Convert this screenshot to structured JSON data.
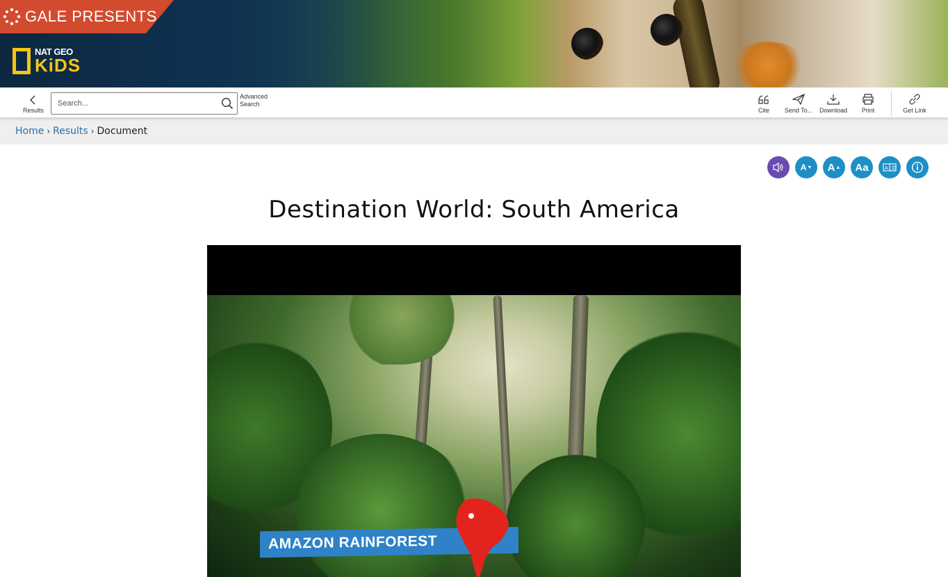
{
  "banner": {
    "tag_text": "GALE PRESENTS",
    "logo_line1": "NAT GEO",
    "logo_line2": "KiDS"
  },
  "toolbar": {
    "back_label": "Results",
    "search_placeholder": "Search...",
    "advanced_line1": "Advanced",
    "advanced_line2": "Search",
    "cite_label": "Cite",
    "send_label": "Send To...",
    "download_label": "Download",
    "print_label": "Print",
    "get_link_label": "Get Link"
  },
  "breadcrumb": {
    "home": "Home",
    "results": "Results",
    "current": "Document",
    "separator": "›"
  },
  "accessibility_tools": [
    {
      "icon": "speaker-icon",
      "color": "#6a4bb0"
    },
    {
      "icon": "decrease-font-icon",
      "color": "#1e8fc6",
      "text": "A"
    },
    {
      "icon": "increase-font-icon",
      "color": "#1e8fc6",
      "text": "A"
    },
    {
      "icon": "font-style-icon",
      "color": "#1e8fc6",
      "text": "Aa"
    },
    {
      "icon": "translate-icon",
      "color": "#1e8fc6"
    },
    {
      "icon": "info-icon",
      "color": "#1e8fc6"
    }
  ],
  "document": {
    "title": "Destination World: South America"
  },
  "video": {
    "overlay_label": "AMAZON RAINFOREST"
  },
  "colors": {
    "gale_red": "#d24b2f",
    "natgeo_yellow": "#f5c518",
    "link_blue": "#2a6fa8",
    "tool_blue": "#1e8fc6",
    "tool_purple": "#6a4bb0"
  }
}
